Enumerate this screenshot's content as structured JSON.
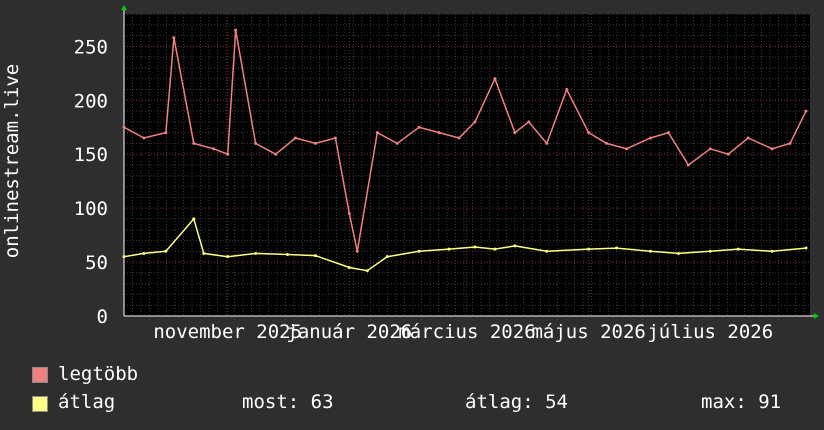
{
  "chart_data": {
    "type": "line",
    "ylabel": "onlinestream.live",
    "ylim": [
      0,
      280
    ],
    "yticks": [
      0,
      50,
      100,
      150,
      200,
      250
    ],
    "x_range": [
      "2025-09-10",
      "2026-08-20"
    ],
    "xticks": [
      {
        "date": "2025-11-01",
        "label": "november 2025"
      },
      {
        "date": "2026-01-01",
        "label": "január 2026"
      },
      {
        "date": "2026-03-01",
        "label": "március 2026"
      },
      {
        "date": "2026-05-01",
        "label": "május 2026"
      },
      {
        "date": "2026-07-01",
        "label": "július 2026"
      }
    ],
    "grid": true,
    "series": [
      {
        "name": "legtöbb",
        "color": "#f08080",
        "x": [
          "2025-09-10",
          "2025-09-20",
          "2025-10-01",
          "2025-10-05",
          "2025-10-15",
          "2025-10-25",
          "2025-11-01",
          "2025-11-05",
          "2025-11-15",
          "2025-11-25",
          "2025-12-05",
          "2025-12-15",
          "2025-12-25",
          "2026-01-01",
          "2026-01-05",
          "2026-01-15",
          "2026-01-25",
          "2026-02-05",
          "2026-02-15",
          "2026-02-25",
          "2026-03-05",
          "2026-03-15",
          "2026-03-25",
          "2026-04-01",
          "2026-04-10",
          "2026-04-20",
          "2026-05-01",
          "2026-05-10",
          "2026-05-20",
          "2026-06-01",
          "2026-06-10",
          "2026-06-20",
          "2026-07-01",
          "2026-07-10",
          "2026-07-20",
          "2026-08-01",
          "2026-08-10",
          "2026-08-18"
        ],
        "y": [
          175,
          165,
          170,
          258,
          160,
          155,
          150,
          265,
          160,
          150,
          165,
          160,
          165,
          95,
          60,
          170,
          160,
          175,
          170,
          165,
          180,
          220,
          170,
          180,
          160,
          210,
          170,
          160,
          155,
          165,
          170,
          140,
          155,
          150,
          165,
          155,
          160,
          190
        ]
      },
      {
        "name": "átlag",
        "color": "#ffff80",
        "x": [
          "2025-09-10",
          "2025-09-20",
          "2025-10-01",
          "2025-10-15",
          "2025-10-20",
          "2025-11-01",
          "2025-11-15",
          "2025-12-01",
          "2025-12-15",
          "2026-01-01",
          "2026-01-10",
          "2026-01-20",
          "2026-02-05",
          "2026-02-20",
          "2026-03-05",
          "2026-03-15",
          "2026-03-25",
          "2026-04-10",
          "2026-05-01",
          "2026-05-15",
          "2026-06-01",
          "2026-06-15",
          "2026-07-01",
          "2026-07-15",
          "2026-08-01",
          "2026-08-18"
        ],
        "y": [
          55,
          58,
          60,
          90,
          58,
          55,
          58,
          57,
          56,
          45,
          42,
          55,
          60,
          62,
          64,
          62,
          65,
          60,
          62,
          63,
          60,
          58,
          60,
          62,
          60,
          63
        ]
      }
    ],
    "legend": [
      {
        "label": "legtöbb",
        "color": "#f08080"
      },
      {
        "label": "átlag",
        "color": "#ffff80"
      }
    ],
    "stats": {
      "most": "most: 63",
      "atlag": "átlag: 54",
      "max": "max: 91"
    }
  }
}
